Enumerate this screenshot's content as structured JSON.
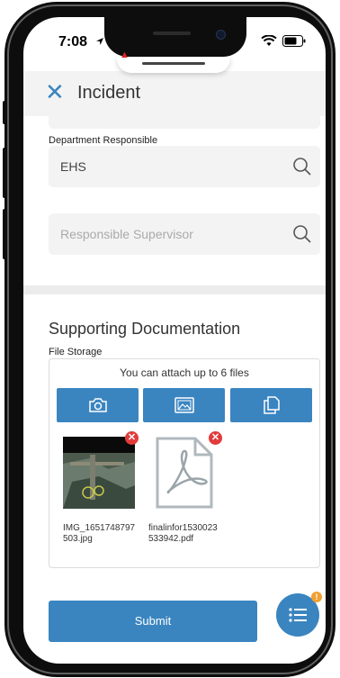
{
  "status_bar": {
    "time": "7:08"
  },
  "header": {
    "title": "Incident",
    "close_icon": "close-icon"
  },
  "department": {
    "label": "Department Responsible",
    "value": "EHS"
  },
  "supervisor": {
    "placeholder": "Responsible Supervisor"
  },
  "supporting_docs": {
    "title": "Supporting Documentation",
    "file_storage_label": "File Storage",
    "attach_note": "You can attach up to 6 files",
    "upload_buttons": [
      "camera-icon",
      "image-gallery-icon",
      "copy-document-icon"
    ],
    "files": [
      {
        "name": "IMG_1651748797503.jpg",
        "type": "image"
      },
      {
        "name": "finalinfor1530023533942.pdf",
        "type": "pdf"
      }
    ]
  },
  "submit_label": "Submit",
  "fab": {
    "badge": "!"
  },
  "colors": {
    "accent": "#3a85c0",
    "delete": "#e23a3a",
    "badge": "#f0a030"
  }
}
